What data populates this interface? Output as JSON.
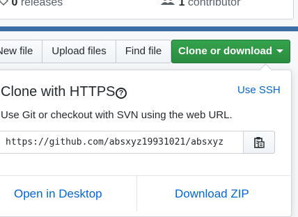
{
  "repo_summary": {
    "releases_count": "0",
    "releases_label": "releases",
    "contributors_count": "1",
    "contributors_label": "contributor"
  },
  "file_actions": {
    "new_file_label": "New file",
    "upload_files_label": "Upload files",
    "find_file_label": "Find file",
    "clone_label": "Clone or download"
  },
  "clone_panel": {
    "title": "Clone with HTTPS",
    "help_icon": "?",
    "use_ssh_label": "Use SSH",
    "description": "Use Git or checkout with SVN using the web URL.",
    "url": "https://github.com/absxyz19931021/absxyz",
    "open_desktop_label": "Open in Desktop",
    "download_zip_label": "Download ZIP"
  },
  "colors": {
    "clone_button": "#2c974b",
    "link": "#0366d6",
    "language_bar": "#3a6ea5"
  },
  "icons": [
    "tag-icon",
    "people-icon",
    "clipboard-icon",
    "caret-down-icon",
    "question-icon"
  ]
}
